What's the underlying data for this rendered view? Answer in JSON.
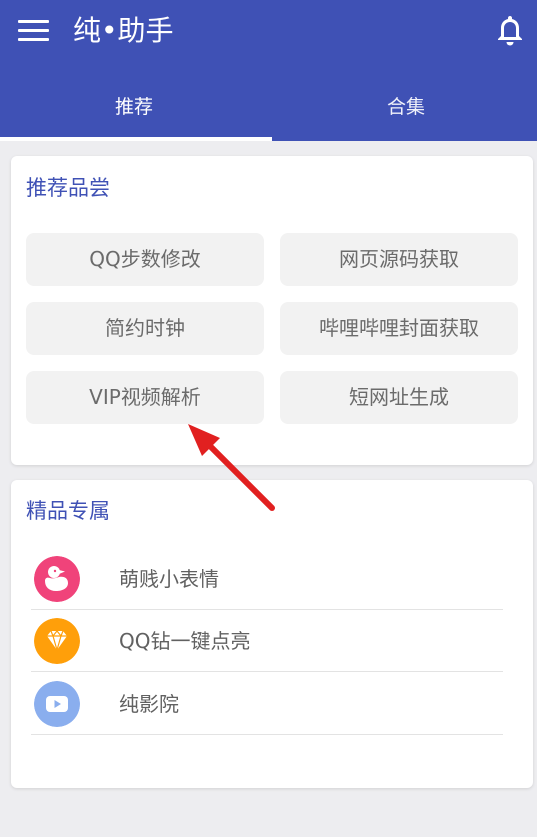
{
  "app": {
    "title": "纯•助手",
    "accent_color": "#3f51b5",
    "menu_icon": "menu-icon",
    "notification_icon": "bell-icon"
  },
  "tabs": [
    {
      "label": "推荐",
      "selected": true
    },
    {
      "label": "合集",
      "selected": false
    }
  ],
  "recommend_section": {
    "title": "推荐品尝",
    "buttons": [
      {
        "label": "QQ步数修改"
      },
      {
        "label": "网页源码获取"
      },
      {
        "label": "简约时钟"
      },
      {
        "label": "哔哩哔哩封面获取"
      },
      {
        "label": "VIP视频解析"
      },
      {
        "label": "短网址生成"
      }
    ]
  },
  "premium_section": {
    "title": "精品专属",
    "items": [
      {
        "label": "萌贱小表情",
        "icon": "duck-icon",
        "icon_color": "#f0437a"
      },
      {
        "label": "QQ钻一键点亮",
        "icon": "diamond-icon",
        "icon_color": "#ff9f0a"
      },
      {
        "label": "纯影院",
        "icon": "play-icon",
        "icon_color": "#8aaeee"
      }
    ]
  },
  "annotation": {
    "type": "red-arrow",
    "color": "#e12020"
  }
}
